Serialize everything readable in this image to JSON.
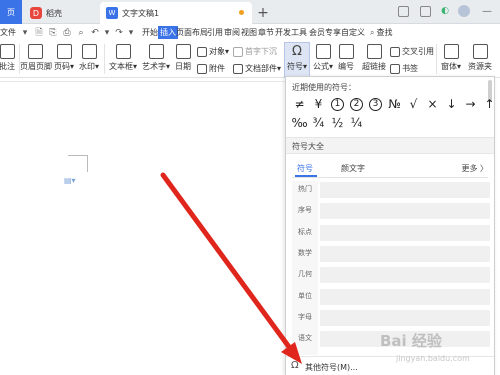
{
  "tabbar": {
    "home_label": "页",
    "tab1_label": "稻壳",
    "tab1_logo": "D",
    "doc_tab_label": "文字文稿1",
    "doc_tab_logo": "W",
    "add_label": "+",
    "controls": [
      "▦",
      "◫",
      "🗋",
      "—"
    ]
  },
  "menubar": {
    "file_label": "文件",
    "items": [
      "开始",
      "插入",
      "页面布局",
      "引用",
      "审阅",
      "视图",
      "章节",
      "开发工具",
      "会员专享",
      "自定义"
    ],
    "active_item": "插入",
    "search_label": "查找",
    "search_icon": "search-icon"
  },
  "ribbon": {
    "buttons": [
      {
        "label": "批注",
        "icon": "comment-icon"
      },
      {
        "label": "页眉页脚",
        "icon": "header-footer-icon"
      },
      {
        "label": "页码▾",
        "icon": "page-number-icon"
      },
      {
        "label": "水印▾",
        "icon": "watermark-icon"
      },
      {
        "label": "文本框▾",
        "icon": "textbox-icon"
      },
      {
        "label": "艺术字▾",
        "icon": "wordart-icon"
      },
      {
        "label": "日期",
        "icon": "date-icon"
      },
      {
        "label": "符号▾",
        "icon": "omega-icon"
      },
      {
        "label": "公式▾",
        "icon": "formula-icon"
      },
      {
        "label": "编号",
        "icon": "numbering-icon"
      },
      {
        "label": "超链接",
        "icon": "hyperlink-icon"
      },
      {
        "label": "窗体▾",
        "icon": "form-icon"
      },
      {
        "label": "资源夹",
        "icon": "resource-icon"
      }
    ],
    "small_buttons": [
      {
        "label": "对象▾",
        "icon": "object-icon"
      },
      {
        "label": "首字下沉",
        "icon": "dropcap-icon"
      },
      {
        "label": "附件",
        "icon": "attachment-icon"
      },
      {
        "label": "文档部件▾",
        "icon": "docpart-icon"
      },
      {
        "label": "交叉引用",
        "icon": "crossref-icon"
      },
      {
        "label": "书签",
        "icon": "bookmark-icon"
      }
    ]
  },
  "symbol_panel": {
    "recent_title": "近期使用的符号：",
    "recent_row1": [
      "≠",
      "¥",
      "①",
      "②",
      "③",
      "№",
      "√",
      "×",
      "↓",
      "→",
      "↑",
      "←"
    ],
    "recent_row2": [
      "‰",
      "¾",
      "½",
      "¼"
    ],
    "section_title": "符号大全",
    "tab_symbol": "符号",
    "tab_pinyin": "颜文字",
    "more_label": "更多 〉",
    "categories": [
      "热门",
      "序号",
      "标点",
      "数学",
      "几何",
      "单位",
      "字母",
      "语文"
    ],
    "footer_label": "其他符号(M)...",
    "footer_icon": "omega-icon"
  },
  "doc": {
    "mini_icon": "paste-options-icon"
  },
  "watermark": {
    "line1": "Bai 经验",
    "line2": "jingyan.baidu.com"
  },
  "colors": {
    "accent": "#3a72e8",
    "arrow": "#e0261c"
  }
}
